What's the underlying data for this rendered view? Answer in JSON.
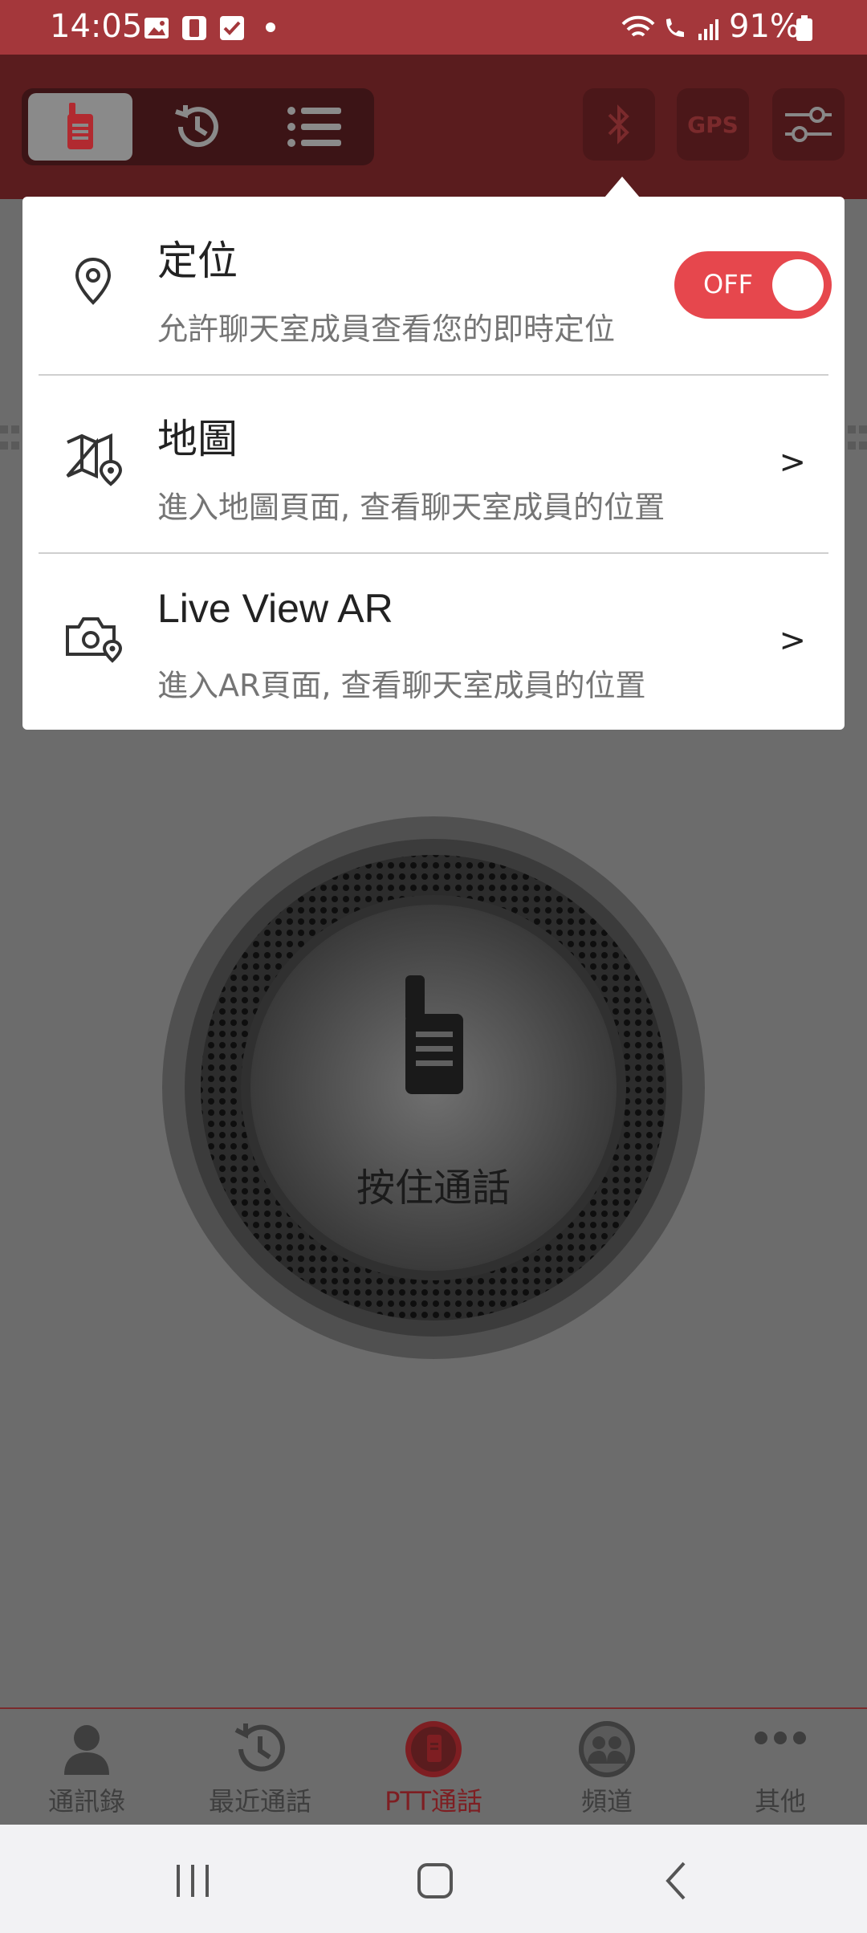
{
  "status_bar": {
    "time": "14:05",
    "battery": "91%"
  },
  "header": {
    "tabs": [
      "ptt-tab",
      "history-tab",
      "list-tab"
    ],
    "gps_label": "GPS"
  },
  "popup": {
    "location": {
      "title": "定位",
      "subtitle": "允許聊天室成員查看您的即時定位",
      "toggle_label": "OFF"
    },
    "map": {
      "title": "地圖",
      "subtitle": "進入地圖頁面, 查看聊天室成員的位置",
      "chevron": ">"
    },
    "ar": {
      "title": "Live View AR",
      "subtitle": "進入AR頁面, 查看聊天室成員的位置",
      "chevron": ">"
    }
  },
  "ptt": {
    "label": "按住通話"
  },
  "bottom_nav": {
    "items": [
      {
        "label": "通訊錄"
      },
      {
        "label": "最近通話"
      },
      {
        "label": "PTT通話"
      },
      {
        "label": "頻道"
      },
      {
        "label": "其他"
      }
    ]
  },
  "colors": {
    "status_bar": "#a4373b",
    "header": "#5a1c1e",
    "accent": "#e6474d",
    "active_nav": "#7e1e22"
  }
}
